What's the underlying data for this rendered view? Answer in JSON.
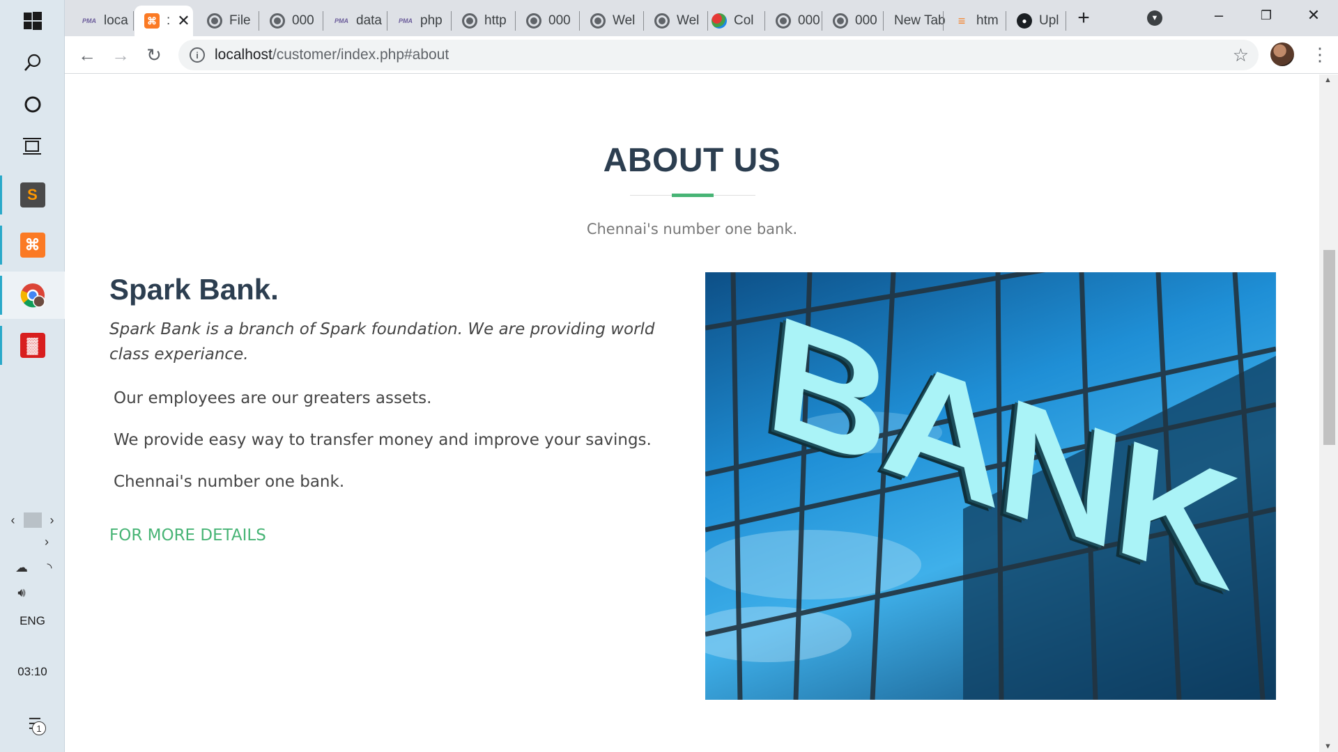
{
  "taskbar": {
    "language": "ENG",
    "time": "03:10",
    "notification_count": "1"
  },
  "tabs": [
    {
      "label": "loca",
      "icon": "phpmyadmin-icon"
    },
    {
      "label": ":",
      "icon": "xampp-icon",
      "active": true
    },
    {
      "label": "File",
      "icon": "globe-icon"
    },
    {
      "label": "000",
      "icon": "globe-icon"
    },
    {
      "label": "data",
      "icon": "phpmyadmin-icon"
    },
    {
      "label": "php",
      "icon": "phpmyadmin-icon"
    },
    {
      "label": "http",
      "icon": "globe-icon"
    },
    {
      "label": "000",
      "icon": "globe-icon"
    },
    {
      "label": "Wel",
      "icon": "globe-icon"
    },
    {
      "label": "Wel",
      "icon": "globe-icon"
    },
    {
      "label": "Col",
      "icon": "colorful-icon"
    },
    {
      "label": "000",
      "icon": "globe-icon"
    },
    {
      "label": "000",
      "icon": "globe-icon"
    },
    {
      "label": "New Tab",
      "icon": ""
    },
    {
      "label": "htm",
      "icon": "stackoverflow-icon"
    },
    {
      "label": "Upl",
      "icon": "github-icon"
    }
  ],
  "address_bar": {
    "host": "localhost",
    "path": "/customer/index.php#about"
  },
  "about": {
    "title": "ABOUT US",
    "subtitle": "Chennai's number one bank.",
    "bank_name": "Spark Bank.",
    "intro": "Spark Bank is a branch of Spark foundation. We are providing world class experiance.",
    "points": [
      "Our employees are our greaters assets.",
      "We provide easy way to transfer money and improve your savings.",
      "Chennai's number one bank."
    ],
    "more_link": "FOR MORE DETAILS",
    "image_text": "BANK"
  },
  "colors": {
    "accent": "#47b475",
    "heading": "#2c3e50",
    "body_text": "#444444"
  }
}
